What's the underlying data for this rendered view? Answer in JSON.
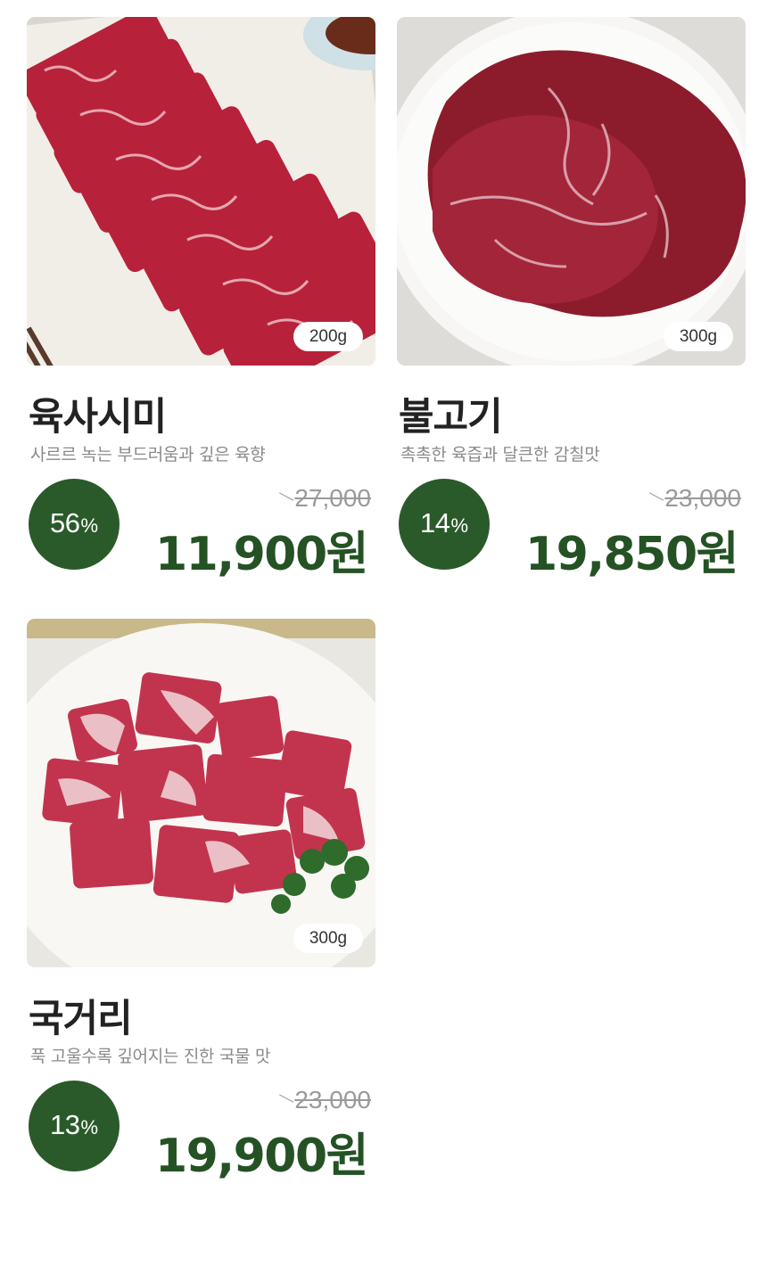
{
  "products": [
    {
      "name": "육사시미",
      "description": "사르르 녹는 부드러움과 깊은 육향",
      "weight": "200g",
      "discount_value": "56",
      "discount_unit": "%",
      "original_price": "27,000",
      "sale_price": "11,900원",
      "image": "sliced-raw-beef-on-plate"
    },
    {
      "name": "불고기",
      "description": "촉촉한 육즙과 달큰한 감칠맛",
      "weight": "300g",
      "discount_value": "14",
      "discount_unit": "%",
      "original_price": "23,000",
      "sale_price": "19,850원",
      "image": "raw-bulgogi-beef-in-bowl"
    },
    {
      "name": "국거리",
      "description": "푹 고울수록 깊어지는 진한 국물 맛",
      "weight": "300g",
      "discount_value": "13",
      "discount_unit": "%",
      "original_price": "23,000",
      "sale_price": "19,900원",
      "image": "cubed-beef-with-parsley"
    }
  ],
  "colors": {
    "accent_green": "#245224",
    "badge_green": "#2a5a2a",
    "muted_text": "#8a8a8a"
  }
}
